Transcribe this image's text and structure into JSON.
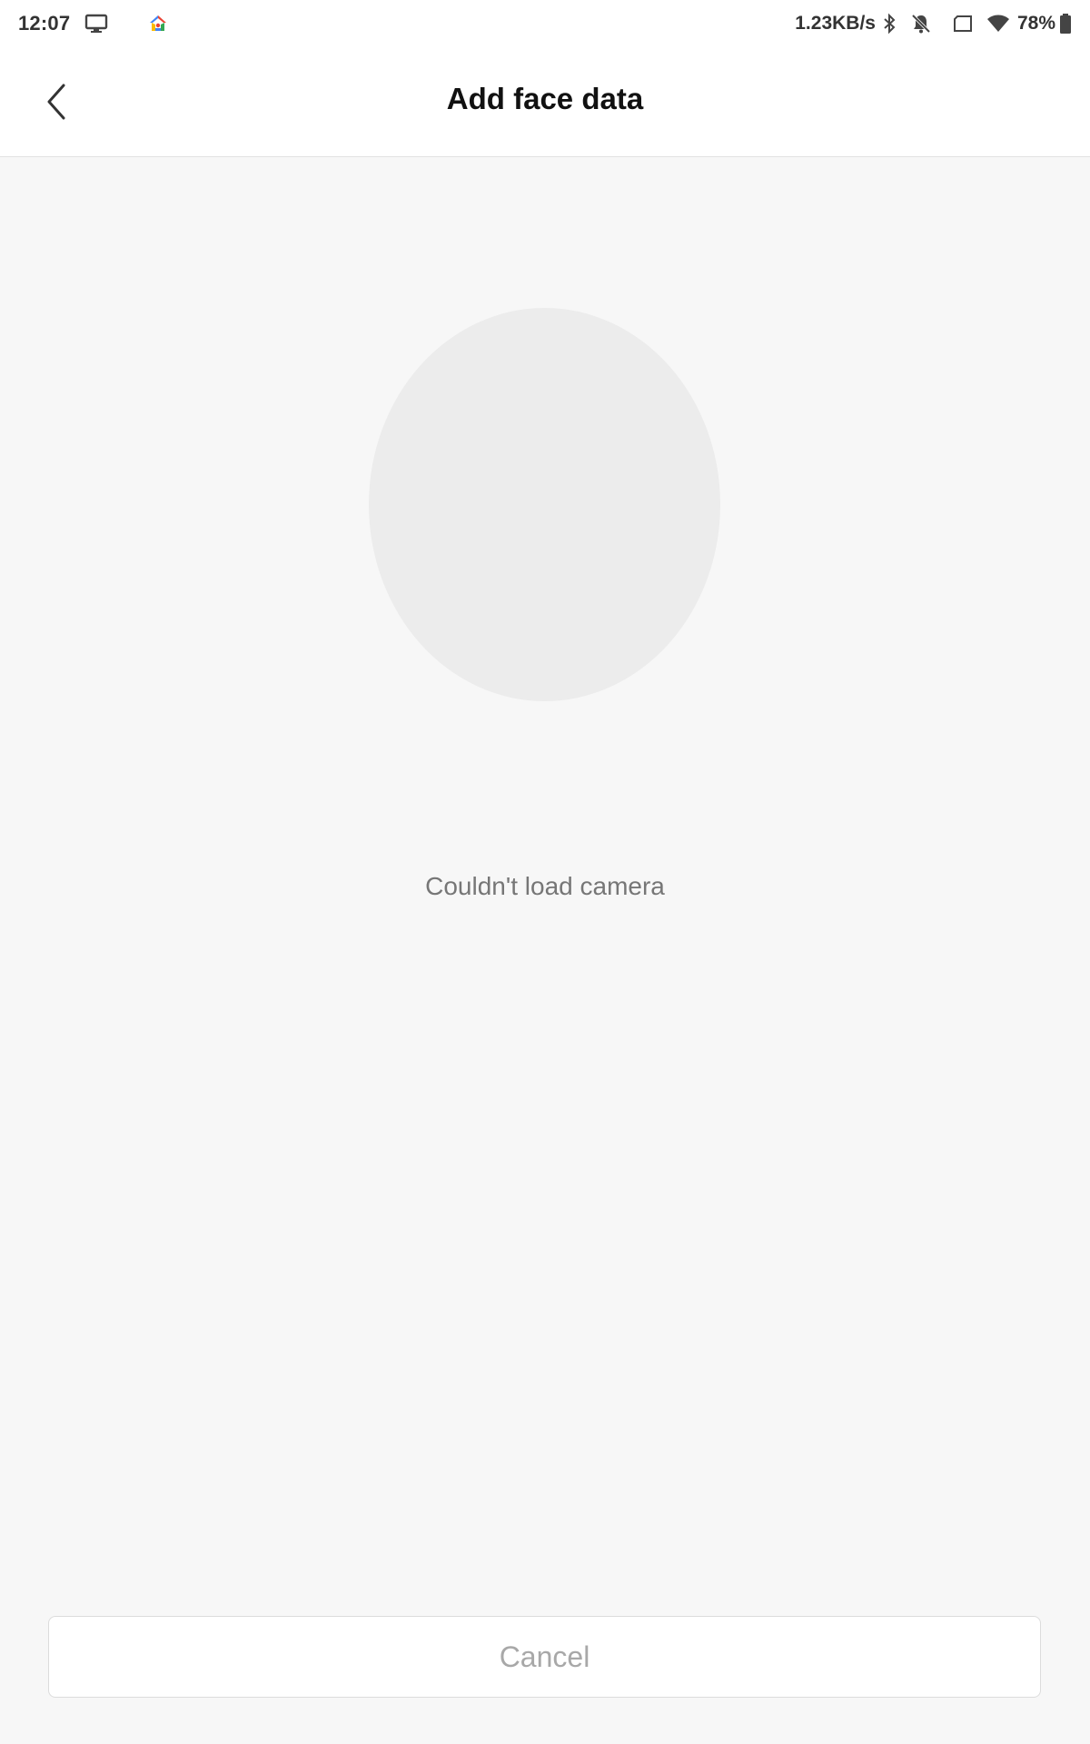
{
  "status_bar": {
    "time": "12:07",
    "net_speed": "1.23KB/s",
    "battery": "78%",
    "icons": [
      "screen-cast-icon",
      "google-home-icon",
      "bluetooth-icon",
      "notifications-off-icon",
      "tablet-icon",
      "wifi-icon",
      "battery-icon"
    ]
  },
  "header": {
    "title": "Add face data",
    "back_icon": "chevron-left-icon"
  },
  "main": {
    "error_message": "Couldn't load camera"
  },
  "footer": {
    "cancel_label": "Cancel"
  },
  "colors": {
    "background": "#f7f7f7",
    "oval": "#ececec",
    "header_bg": "#ffffff",
    "cancel_text": "#a8a8a8"
  }
}
